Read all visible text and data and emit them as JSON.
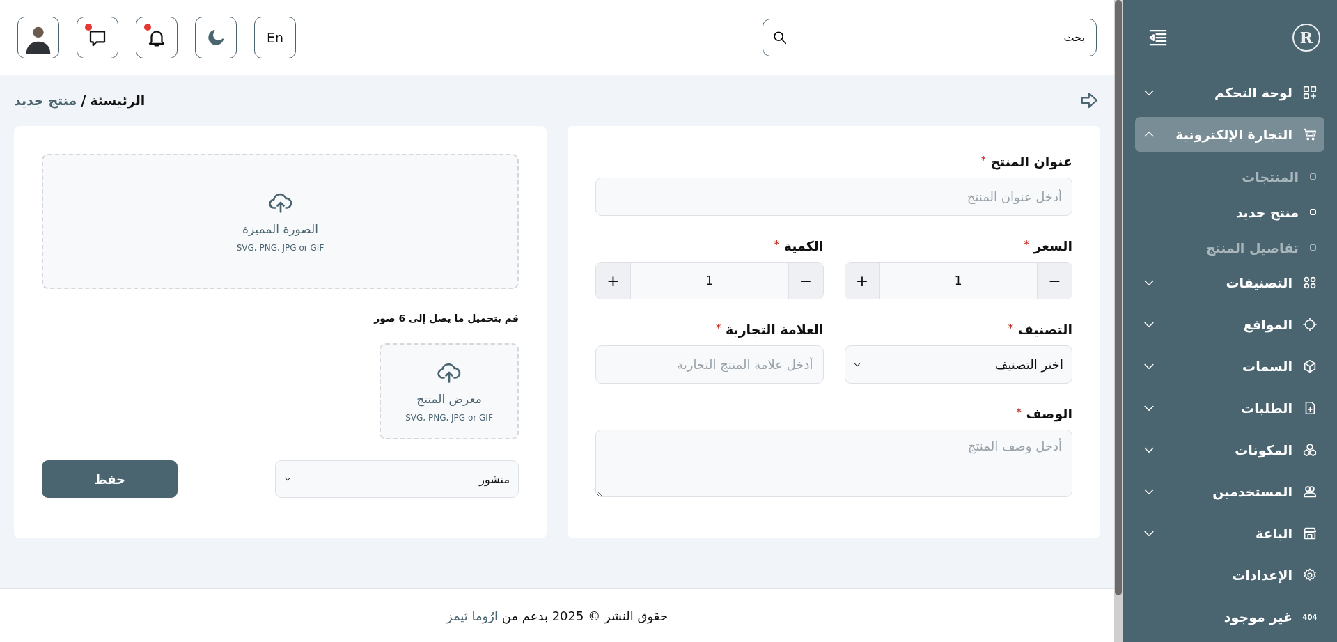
{
  "sidebar": {
    "logo": "R",
    "items": [
      {
        "label": "لوحة التحكم",
        "kind": "group",
        "expanded": false,
        "selected": false
      },
      {
        "label": "التجارة الإلكترونية",
        "kind": "group",
        "expanded": true,
        "selected": true,
        "children": [
          {
            "label": "المنتجات",
            "selected": false
          },
          {
            "label": "منتج جديد",
            "selected": true
          },
          {
            "label": "تفاصيل المنتج",
            "selected": false
          }
        ]
      },
      {
        "label": "التصنيفات",
        "kind": "group",
        "expanded": false,
        "selected": false
      },
      {
        "label": "المواقع",
        "kind": "group",
        "expanded": false,
        "selected": false
      },
      {
        "label": "السمات",
        "kind": "group",
        "expanded": false,
        "selected": false
      },
      {
        "label": "الطلبات",
        "kind": "group",
        "expanded": false,
        "selected": false
      },
      {
        "label": "المكونات",
        "kind": "group",
        "expanded": false,
        "selected": false
      },
      {
        "label": "المستخدمين",
        "kind": "group",
        "expanded": false,
        "selected": false
      },
      {
        "label": "الباعة",
        "kind": "group",
        "expanded": false,
        "selected": false
      },
      {
        "label": "الإعدادات",
        "kind": "link",
        "selected": false
      },
      {
        "label": "غير موجود",
        "kind": "link",
        "selected": false,
        "badge": "404"
      }
    ]
  },
  "header": {
    "search": {
      "placeholder": "بحث"
    },
    "language": "En",
    "buttons": [
      {
        "kind": "theme",
        "has_alert": false
      },
      {
        "kind": "notifications",
        "has_alert": true
      },
      {
        "kind": "messages",
        "has_alert": true
      },
      {
        "kind": "profile",
        "has_alert": false
      }
    ]
  },
  "breadcrumb": {
    "items": [
      "الرئيسئة",
      "منتج جديد"
    ],
    "separator": "/"
  },
  "form": {
    "required_mark": "*",
    "fields": [
      {
        "kind": "text",
        "label": "عنوان المنتج",
        "required": true,
        "placeholder": "أدخل عنوان المنتج"
      },
      {
        "kind": "stepper",
        "label": "السعر",
        "required": true,
        "value": "1",
        "decrement": "−",
        "increment": "+"
      },
      {
        "kind": "stepper",
        "label": "الكمية",
        "required": true,
        "value": "1",
        "decrement": "−",
        "increment": "+"
      },
      {
        "kind": "select",
        "label": "التصنيف",
        "required": true,
        "value": "اختر التصنيف"
      },
      {
        "kind": "text",
        "label": "العلامة التجارية",
        "required": true,
        "placeholder": "أدخل علامة المنتج التجارية"
      },
      {
        "kind": "textarea",
        "label": "الوصف",
        "required": true,
        "placeholder": "أدخل وصف المنتج"
      }
    ]
  },
  "media": {
    "featured": {
      "title": "الصورة المميزة",
      "formats": "SVG, PNG, JPG or GIF"
    },
    "note": "قم بتحميل ما يصل إلى 6 صور",
    "gallery": {
      "title": "معرض المنتج",
      "formats": "SVG, PNG, JPG or GIF"
    },
    "status": "منشور",
    "save": "حفظ"
  },
  "footer": {
    "text": "حقوق النشر © 2025 بدعم من",
    "link": "ارُوما ثيمز"
  }
}
